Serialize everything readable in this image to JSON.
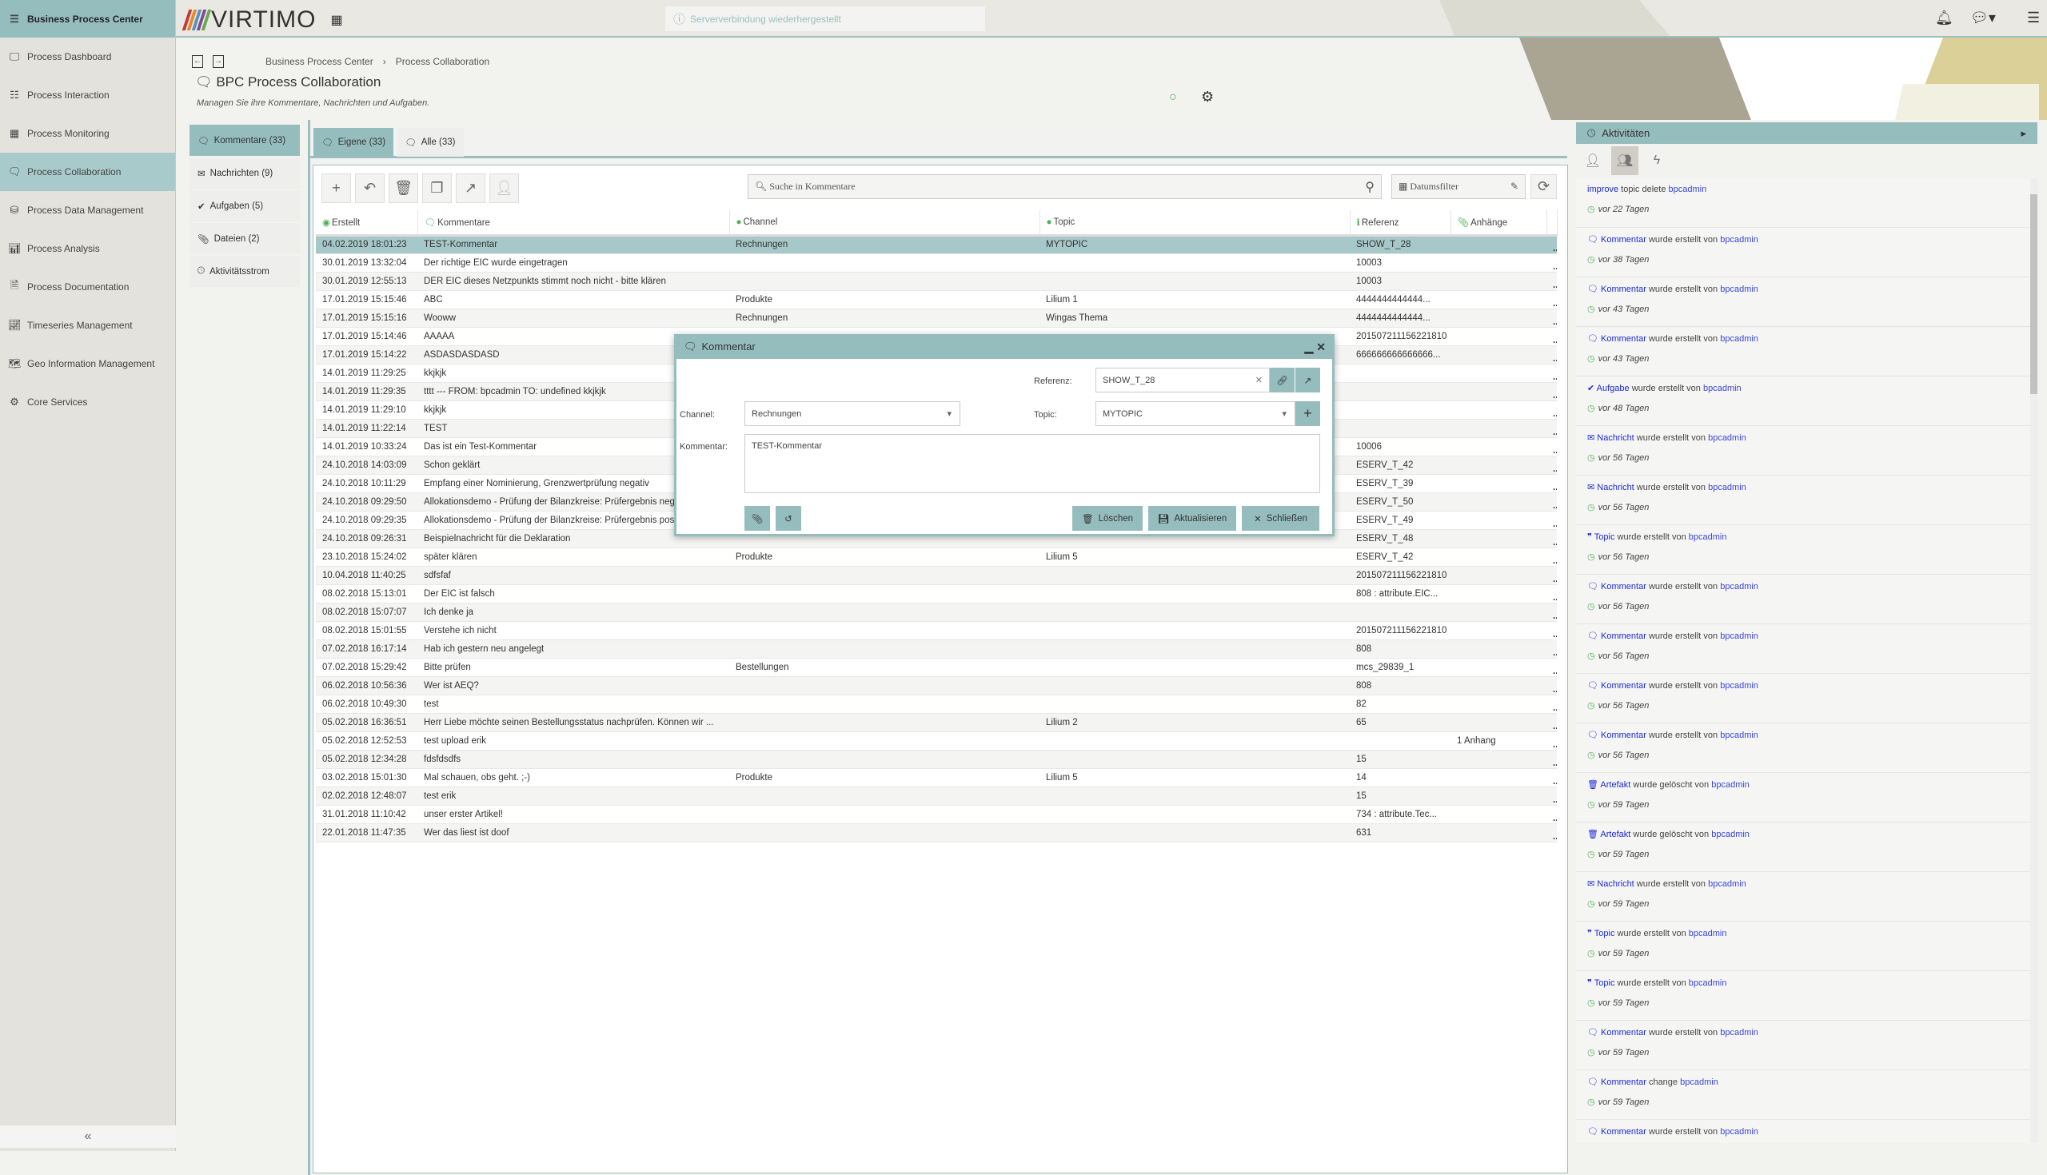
{
  "sidebar": {
    "brand": "Business Process Center",
    "items": [
      {
        "label": "Process Dashboard",
        "icon": "monitor-icon"
      },
      {
        "label": "Process Interaction",
        "icon": "list-icon"
      },
      {
        "label": "Process Monitoring",
        "icon": "table-icon"
      },
      {
        "label": "Process Collaboration",
        "icon": "chat-icon",
        "active": true
      },
      {
        "label": "Process Data Management",
        "icon": "database-icon"
      },
      {
        "label": "Process Analysis",
        "icon": "bar-chart-icon"
      },
      {
        "label": "Process Documentation",
        "icon": "document-icon"
      },
      {
        "label": "Timeseries Management",
        "icon": "line-chart-icon"
      },
      {
        "label": "Geo Information Management",
        "icon": "map-icon"
      },
      {
        "label": "Core Services",
        "icon": "gears-icon"
      }
    ],
    "collapse": "«"
  },
  "topbar": {
    "logo": "VIRTIMO",
    "notice": "Serververbindung wiederhergestellt"
  },
  "breadcrumb": [
    "Business Process Center",
    "Process Collaboration"
  ],
  "page": {
    "title": "BPC Process Collaboration",
    "subtitle": "Managen Sie ihre Kommentare, Nachrichten und Aufgaben."
  },
  "vtabs": [
    {
      "label": "Kommentare (33)",
      "icon": "chat-icon",
      "active": true
    },
    {
      "label": "Nachrichten (9)",
      "icon": "envelope-icon"
    },
    {
      "label": "Aufgaben (5)",
      "icon": "check-circle-icon"
    },
    {
      "label": "Dateien (2)",
      "icon": "paperclip-icon"
    },
    {
      "label": "Aktivitätsstrom",
      "icon": "clock-icon"
    }
  ],
  "htabs": [
    {
      "label": "Eigene (33)",
      "active": true
    },
    {
      "label": "Alle (33)"
    }
  ],
  "toolbar": {
    "search_placeholder": "Suche in Kommentare",
    "date_filter": "Datumsfilter"
  },
  "table": {
    "columns": [
      "Erstellt",
      "Kommentare",
      "Channel",
      "Topic",
      "Referenz",
      "Anhänge"
    ],
    "rows": [
      [
        "04.02.2019 18:01:23",
        "TEST-Kommentar",
        "Rechnungen",
        "MYTOPIC",
        "SHOW_T_28",
        ""
      ],
      [
        "30.01.2019 13:32:04",
        "Der richtige EIC wurde eingetragen",
        "",
        "",
        "10003",
        ""
      ],
      [
        "30.01.2019 12:55:13",
        "DER EIC dieses Netzpunkts stimmt noch nicht - bitte klären",
        "",
        "",
        "10003",
        ""
      ],
      [
        "17.01.2019 15:15:46",
        "ABC",
        "Produkte",
        "Lilium 1",
        "4444444444444...",
        ""
      ],
      [
        "17.01.2019 15:15:16",
        "Wooww",
        "Rechnungen",
        "Wingas Thema",
        "4444444444444...",
        ""
      ],
      [
        "17.01.2019 15:14:46",
        "AAAAA",
        "",
        "",
        "201507211156221810",
        ""
      ],
      [
        "17.01.2019 15:14:22",
        "ASDASDASDASD",
        "",
        "",
        "666666666666666...",
        ""
      ],
      [
        "14.01.2019 11:29:25",
        "kkjkjk",
        "",
        "",
        "",
        ""
      ],
      [
        "14.01.2019 11:29:35",
        "tttt --- FROM: bpcadmin TO: undefined kkjkjk",
        "",
        "",
        "",
        ""
      ],
      [
        "14.01.2019 11:29:10",
        "kkjkjk",
        "",
        "",
        "",
        ""
      ],
      [
        "14.01.2019 11:22:14",
        "TEST",
        "",
        "",
        "",
        ""
      ],
      [
        "14.01.2019 10:33:24",
        "Das ist ein Test-Kommentar",
        "",
        "",
        "10006",
        ""
      ],
      [
        "24.10.2018 14:03:09",
        "Schon geklärt",
        "",
        "",
        "ESERV_T_42",
        ""
      ],
      [
        "24.10.2018 10:11:29",
        "Empfang einer Nominierung, Grenzwertprüfung negativ",
        "",
        "",
        "ESERV_T_39",
        ""
      ],
      [
        "24.10.2018 09:29:50",
        "Allokationsdemo - Prüfung der Bilanzkreise: Prüfergebnis negativ",
        "",
        "",
        "ESERV_T_50",
        ""
      ],
      [
        "24.10.2018 09:29:35",
        "Allokationsdemo - Prüfung der Bilanzkreise: Prüfergebnis positiv",
        "",
        "",
        "ESERV_T_49",
        ""
      ],
      [
        "24.10.2018 09:26:31",
        "Beispielnachricht für die Deklaration",
        "",
        "",
        "ESERV_T_48",
        ""
      ],
      [
        "23.10.2018 15:24:02",
        "später klären",
        "Produkte",
        "Lilium 5",
        "ESERV_T_42",
        ""
      ],
      [
        "10.04.2018 11:40:25",
        "sdfsfaf",
        "",
        "",
        "201507211156221810",
        ""
      ],
      [
        "08.02.2018 15:13:01",
        "Der EIC ist falsch",
        "",
        "",
        "808 : attribute.EIC...",
        ""
      ],
      [
        "08.02.2018 15:07:07",
        "Ich denke ja",
        "",
        "",
        "",
        ""
      ],
      [
        "08.02.2018 15:01:55",
        "Verstehe ich nicht",
        "",
        "",
        "201507211156221810",
        ""
      ],
      [
        "07.02.2018 16:17:14",
        "Hab ich gestern neu angelegt",
        "",
        "",
        "808",
        ""
      ],
      [
        "07.02.2018 15:29:42",
        "Bitte prüfen",
        "Bestellungen",
        "",
        "mcs_29839_1",
        ""
      ],
      [
        "06.02.2018 10:56:36",
        "Wer ist AEQ?",
        "",
        "",
        "808",
        ""
      ],
      [
        "06.02.2018 10:49:30",
        "test",
        "",
        "",
        "82",
        ""
      ],
      [
        "05.02.2018 16:36:51",
        "Herr Liebe möchte seinen Bestellungsstatus nachprüfen. Können wir ...",
        "",
        "Lilium 2",
        "65",
        ""
      ],
      [
        "05.02.2018 12:52:53",
        "test upload erik",
        "",
        "",
        "",
        "1 Anhang"
      ],
      [
        "05.02.2018 12:34:28",
        "fdsfdsdfs",
        "",
        "",
        "15",
        ""
      ],
      [
        "03.02.2018 15:01:30",
        "Mal schauen, obs geht. ;-)",
        "Produkte",
        "Lilium 5",
        "14",
        ""
      ],
      [
        "02.02.2018 12:48:07",
        "test erik",
        "",
        "",
        "15",
        ""
      ],
      [
        "31.01.2018 11:10:42",
        "unser erster Artikel!",
        "",
        "",
        "734 : attribute.Tec...",
        ""
      ],
      [
        "22.01.2018 11:47:35",
        "Wer das liest ist doof",
        "",
        "",
        "631",
        ""
      ]
    ],
    "row_menu": "..."
  },
  "dialog": {
    "title": "Kommentar",
    "referenz_label": "Referenz:",
    "referenz_value": "SHOW_T_28",
    "channel_label": "Channel:",
    "channel_value": "Rechnungen",
    "topic_label": "Topic:",
    "topic_value": "MYTOPIC",
    "kommentar_label": "Kommentar:",
    "kommentar_value": "TEST-Kommentar",
    "delete": "Löschen",
    "update": "Aktualisieren",
    "close": "Schließen"
  },
  "activity": {
    "title": "Aktivitäten",
    "items": [
      {
        "kw": "improve",
        "text": " topic delete ",
        "user": "bpcadmin",
        "time": "vor 22 Tagen",
        "icon": ""
      },
      {
        "kw": "Kommentar",
        "text": " wurde erstellt von ",
        "user": "bpcadmin",
        "time": "vor 38 Tagen",
        "icon": "chat-icon"
      },
      {
        "kw": "Kommentar",
        "text": " wurde erstellt von ",
        "user": "bpcadmin",
        "time": "vor 43 Tagen",
        "icon": "chat-icon"
      },
      {
        "kw": "Kommentar",
        "text": " wurde erstellt von ",
        "user": "bpcadmin",
        "time": "vor 43 Tagen",
        "icon": "chat-icon"
      },
      {
        "kw": "Aufgabe",
        "text": " wurde erstellt von ",
        "user": "bpcadmin",
        "time": "vor 48 Tagen",
        "icon": "check-circle-icon"
      },
      {
        "kw": "Nachricht",
        "text": " wurde erstellt von ",
        "user": "bpcadmin",
        "time": "vor 56 Tagen",
        "icon": "envelope-icon"
      },
      {
        "kw": "Nachricht",
        "text": " wurde erstellt von ",
        "user": "bpcadmin",
        "time": "vor 56 Tagen",
        "icon": "envelope-icon"
      },
      {
        "kw": "Topic",
        "text": " wurde erstellt von ",
        "user": "bpcadmin",
        "time": "vor 56 Tagen",
        "icon": "quote-icon"
      },
      {
        "kw": "Kommentar",
        "text": " wurde erstellt von ",
        "user": "bpcadmin",
        "time": "vor 56 Tagen",
        "icon": "chat-icon"
      },
      {
        "kw": "Kommentar",
        "text": " wurde erstellt von ",
        "user": "bpcadmin",
        "time": "vor 56 Tagen",
        "icon": "chat-icon"
      },
      {
        "kw": "Kommentar",
        "text": " wurde erstellt von ",
        "user": "bpcadmin",
        "time": "vor 56 Tagen",
        "icon": "chat-icon"
      },
      {
        "kw": "Kommentar",
        "text": " wurde erstellt von ",
        "user": "bpcadmin",
        "time": "vor 56 Tagen",
        "icon": "chat-icon"
      },
      {
        "kw": "Artefakt",
        "text": " wurde gelöscht von ",
        "user": "bpcadmin",
        "time": "vor 59 Tagen",
        "icon": "trash-icon"
      },
      {
        "kw": "Artefakt",
        "text": " wurde gelöscht von ",
        "user": "bpcadmin",
        "time": "vor 59 Tagen",
        "icon": "trash-icon"
      },
      {
        "kw": "Nachricht",
        "text": " wurde erstellt von ",
        "user": "bpcadmin",
        "time": "vor 59 Tagen",
        "icon": "envelope-icon"
      },
      {
        "kw": "Topic",
        "text": " wurde erstellt von ",
        "user": "bpcadmin",
        "time": "vor 59 Tagen",
        "icon": "quote-icon"
      },
      {
        "kw": "Topic",
        "text": " wurde erstellt von ",
        "user": "bpcadmin",
        "time": "vor 59 Tagen",
        "icon": "quote-icon"
      },
      {
        "kw": "Kommentar",
        "text": " wurde erstellt von ",
        "user": "bpcadmin",
        "time": "vor 59 Tagen",
        "icon": "chat-icon"
      },
      {
        "kw": "Kommentar",
        "text": " change ",
        "user": "bpcadmin",
        "time": "vor 59 Tagen",
        "icon": "chat-icon"
      },
      {
        "kw": "Kommentar",
        "text": " wurde erstellt von ",
        "user": "bpcadmin",
        "time": "",
        "icon": "chat-icon"
      }
    ]
  },
  "colors": {
    "accent": "#96bdbe",
    "link": "#1b2bd6",
    "status_ok": "#4caf50"
  }
}
